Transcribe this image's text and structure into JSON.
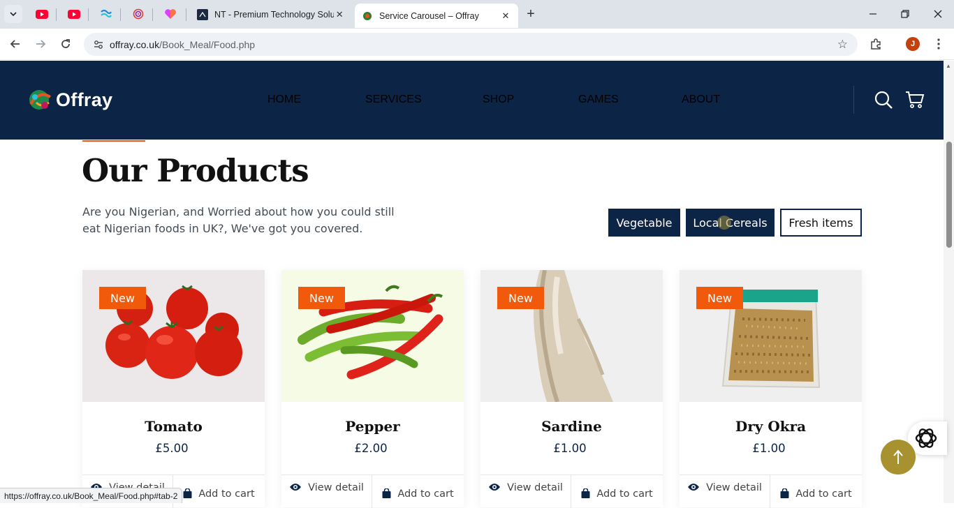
{
  "browser": {
    "tabs": [
      {
        "title": "NT - Premium Technology Solut",
        "active": false
      },
      {
        "title": "Service Carousel – Offray",
        "active": true
      }
    ],
    "pinned_icons": [
      "youtube-icon",
      "youtube-icon",
      "wave-app-icon",
      "spiral-app-icon",
      "heart-app-icon"
    ],
    "url_domain": "offray.co.uk",
    "url_path": "/Book_Meal/Food.php",
    "profile_initial": "J",
    "status_url": "https://offray.co.uk/Book_Meal/Food.php#tab-2"
  },
  "site": {
    "logo_text": "Offray",
    "nav": [
      "HOME",
      "SERVICES",
      "SHOP",
      "GAMES",
      "ABOUT"
    ],
    "colors": {
      "primary": "#0c2446",
      "accent": "#f05a0a",
      "back_to_top": "#a8912f"
    }
  },
  "section": {
    "title": "Our Products",
    "intro": "Are you Nigerian, and Worried about how you could still eat Nigerian foods in UK?, We've got you covered.",
    "filters": [
      "Vegetable",
      "Local Cereals",
      "Fresh items"
    ]
  },
  "products": [
    {
      "badge": "New",
      "name": "Tomato",
      "price": "£5.00",
      "view_label": "View detail",
      "cart_label": "Add to cart"
    },
    {
      "badge": "New",
      "name": "Pepper",
      "price": "£2.00",
      "view_label": "View detail",
      "cart_label": "Add to cart"
    },
    {
      "badge": "New",
      "name": "Sardine",
      "price": "£1.00",
      "view_label": "View detail",
      "cart_label": "Add to cart"
    },
    {
      "badge": "New",
      "name": "Dry Okra",
      "price": "£1.00",
      "view_label": "View detail",
      "cart_label": "Add to cart"
    }
  ]
}
